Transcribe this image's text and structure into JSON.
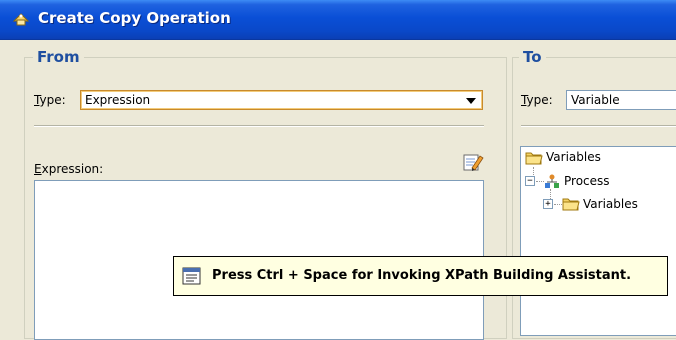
{
  "window": {
    "title": "Create Copy Operation",
    "icon": "copy-operation-icon"
  },
  "from": {
    "legend": "From",
    "type_label_prefix": "T",
    "type_label_rest": "ype:",
    "type_value": "Expression",
    "expression_label_prefix": "E",
    "expression_label_rest": "xpression:",
    "expression_value": ""
  },
  "to": {
    "legend": "To",
    "type_label_prefix": "T",
    "type_label_rest": "ype:",
    "type_value": "Variable",
    "tree": {
      "root": "Variables",
      "process": "Process",
      "child": "Variables"
    }
  },
  "tooltip": {
    "text": "Press Ctrl + Space for Invoking XPath Building Assistant.",
    "icon": "xpath-assistant-icon"
  },
  "colors": {
    "title_bar": "#0a4fd6",
    "legend": "#1f4fa0",
    "tooltip_bg": "#ffffe1",
    "dialog_bg": "#ece9d8"
  }
}
